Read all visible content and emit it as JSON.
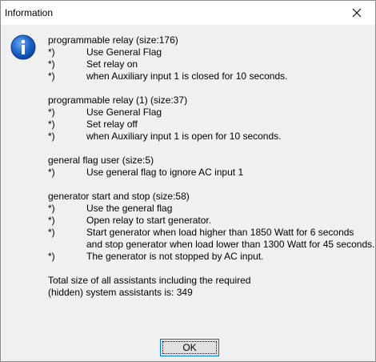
{
  "window": {
    "title": "Information"
  },
  "sections": [
    {
      "header": "programmable relay (size:176)",
      "items": [
        {
          "marker": "*)",
          "lines": [
            "Use General Flag"
          ]
        },
        {
          "marker": "*)",
          "lines": [
            "Set relay on"
          ]
        },
        {
          "marker": "*)",
          "lines": [
            "when Auxiliary input 1 is closed for 10 seconds."
          ]
        }
      ]
    },
    {
      "header": "programmable relay (1) (size:37)",
      "items": [
        {
          "marker": "*)",
          "lines": [
            "Use General Flag"
          ]
        },
        {
          "marker": "*)",
          "lines": [
            "Set relay off"
          ]
        },
        {
          "marker": "*)",
          "lines": [
            "when Auxiliary input 1 is open for 10 seconds."
          ]
        }
      ]
    },
    {
      "header": "general flag user (size:5)",
      "items": [
        {
          "marker": "*)",
          "lines": [
            "Use general flag to ignore AC input 1"
          ]
        }
      ]
    },
    {
      "header": "generator start and stop (size:58)",
      "items": [
        {
          "marker": "*)",
          "lines": [
            "Use the general flag"
          ]
        },
        {
          "marker": "*)",
          "lines": [
            "Open relay to start generator."
          ]
        },
        {
          "marker": "*)",
          "lines": [
            "Start generator when load higher than 1850 Watt for 6 seconds",
            "and stop generator when load lower than 1300 Watt for 45 seconds."
          ]
        },
        {
          "marker": "*)",
          "lines": [
            "The generator is not stopped by AC input."
          ]
        }
      ]
    }
  ],
  "total": {
    "line1": "Total size of all assistants including the required",
    "line2": "(hidden) system assistants is: 349"
  },
  "buttons": {
    "ok_label": "OK"
  },
  "icons": {
    "close": "close-icon",
    "info": "info-icon"
  },
  "colors": {
    "icon_blue": "#1a5fc8",
    "focus_border": "#0078d7"
  }
}
